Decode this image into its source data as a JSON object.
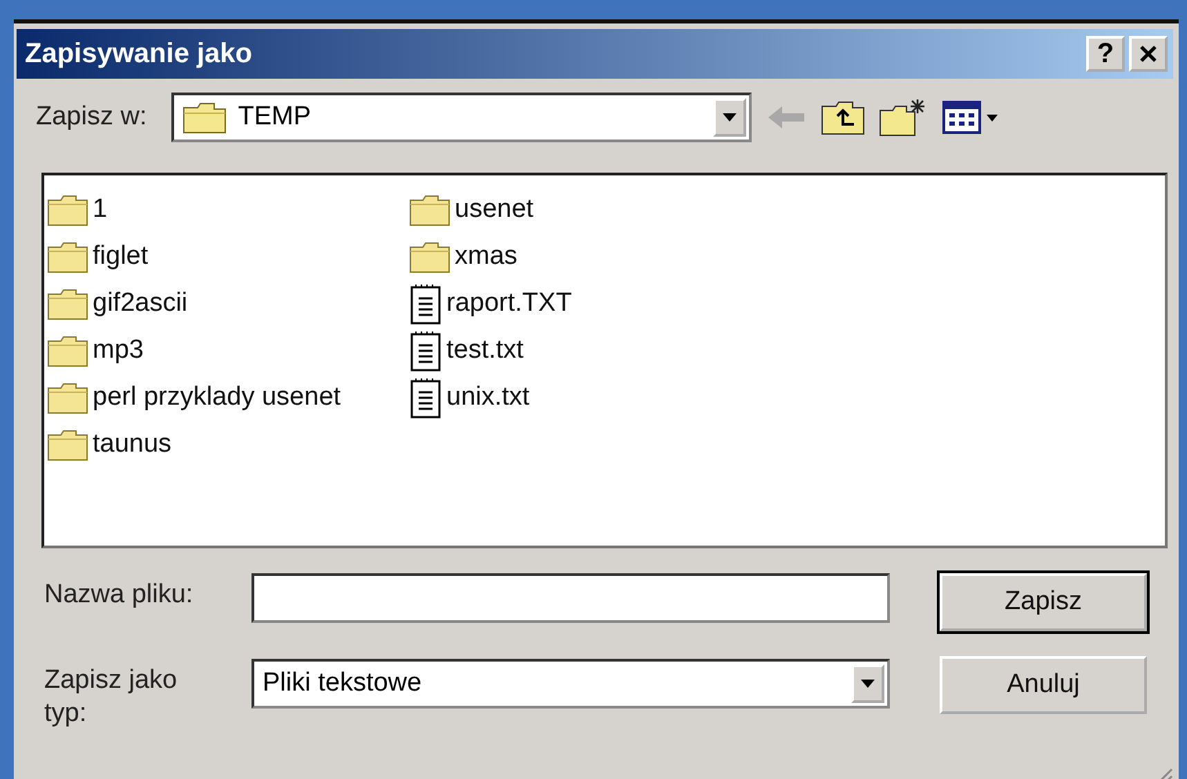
{
  "window": {
    "title": "Zapisywanie jako",
    "help_button": "?"
  },
  "location": {
    "label": "Zapisz w:",
    "value": "TEMP"
  },
  "files": [
    {
      "name": "1",
      "kind": "folder"
    },
    {
      "name": "figlet",
      "kind": "folder"
    },
    {
      "name": "gif2ascii",
      "kind": "folder"
    },
    {
      "name": "mp3",
      "kind": "folder"
    },
    {
      "name": "perl przyklady usenet",
      "kind": "folder"
    },
    {
      "name": "taunus",
      "kind": "folder"
    },
    {
      "name": "usenet",
      "kind": "folder"
    },
    {
      "name": "xmas",
      "kind": "folder"
    },
    {
      "name": "raport.TXT",
      "kind": "text"
    },
    {
      "name": "test.txt",
      "kind": "text"
    },
    {
      "name": "unix.txt",
      "kind": "text"
    }
  ],
  "file_name": {
    "label": "Nazwa pliku:"
  },
  "file_type": {
    "label": "Zapisz jako typ:",
    "value": "Pliki tekstowe"
  },
  "buttons": [
    "Zapisz",
    "Anuluj"
  ]
}
